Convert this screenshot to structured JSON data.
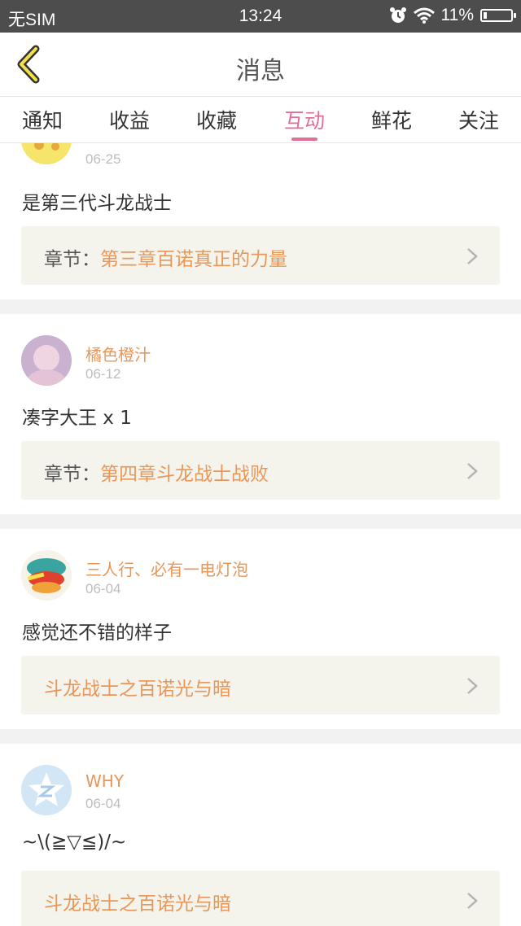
{
  "status_bar": {
    "carrier": "无SIM",
    "time": "13:24",
    "battery": "11%",
    "battery_level": 0.11
  },
  "header": {
    "title": "消息"
  },
  "tabs": [
    {
      "label": "通知",
      "active": false
    },
    {
      "label": "收益",
      "active": false
    },
    {
      "label": "收藏",
      "active": false
    },
    {
      "label": "互动",
      "active": true
    },
    {
      "label": "鲜花",
      "active": false
    },
    {
      "label": "关注",
      "active": false
    }
  ],
  "colors": {
    "accent": "#e36d99",
    "link": "#e8975a",
    "ref_bg": "#f4f4ec"
  },
  "messages": [
    {
      "username": "",
      "date": "06-25",
      "comment": "是第三代斗龙战士",
      "ref_label": "章节：",
      "ref_value": "第三章百诺真正的力量"
    },
    {
      "username": "橘色橙汁",
      "date": "06-12",
      "comment": "凑字大王 x 1",
      "ref_label": "章节：",
      "ref_value": "第四章斗龙战士战败"
    },
    {
      "username": "三人行、必有一电灯泡",
      "date": "06-04",
      "comment": "感觉还不错的样子",
      "ref_label": "",
      "ref_value": "斗龙战士之百诺光与暗"
    },
    {
      "username": "WHY",
      "date": "06-04",
      "comment": "~\\(≧▽≦)/~",
      "ref_label": "",
      "ref_value": "斗龙战士之百诺光与暗"
    }
  ]
}
